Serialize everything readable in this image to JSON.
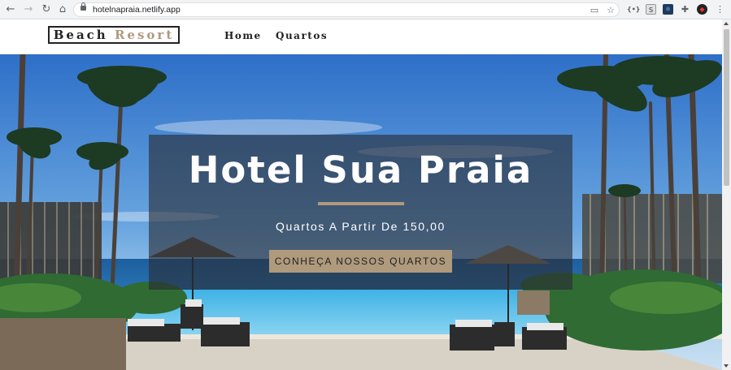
{
  "browser": {
    "url": "hotelnapraia.netlify.app"
  },
  "header": {
    "logo_word1": "Beach",
    "logo_word2": "Resort",
    "nav": [
      {
        "label": "Home"
      },
      {
        "label": "Quartos"
      }
    ]
  },
  "hero": {
    "title": "Hotel Sua Praia",
    "subtitle": "Quartos A Partir De 150,00",
    "cta_label": "CONHEÇA NOSSOS QUARTOS"
  },
  "colors": {
    "accent": "#af9a7d",
    "text_dark": "#222222",
    "banner_overlay": "rgba(40,44,52,0.62)"
  }
}
